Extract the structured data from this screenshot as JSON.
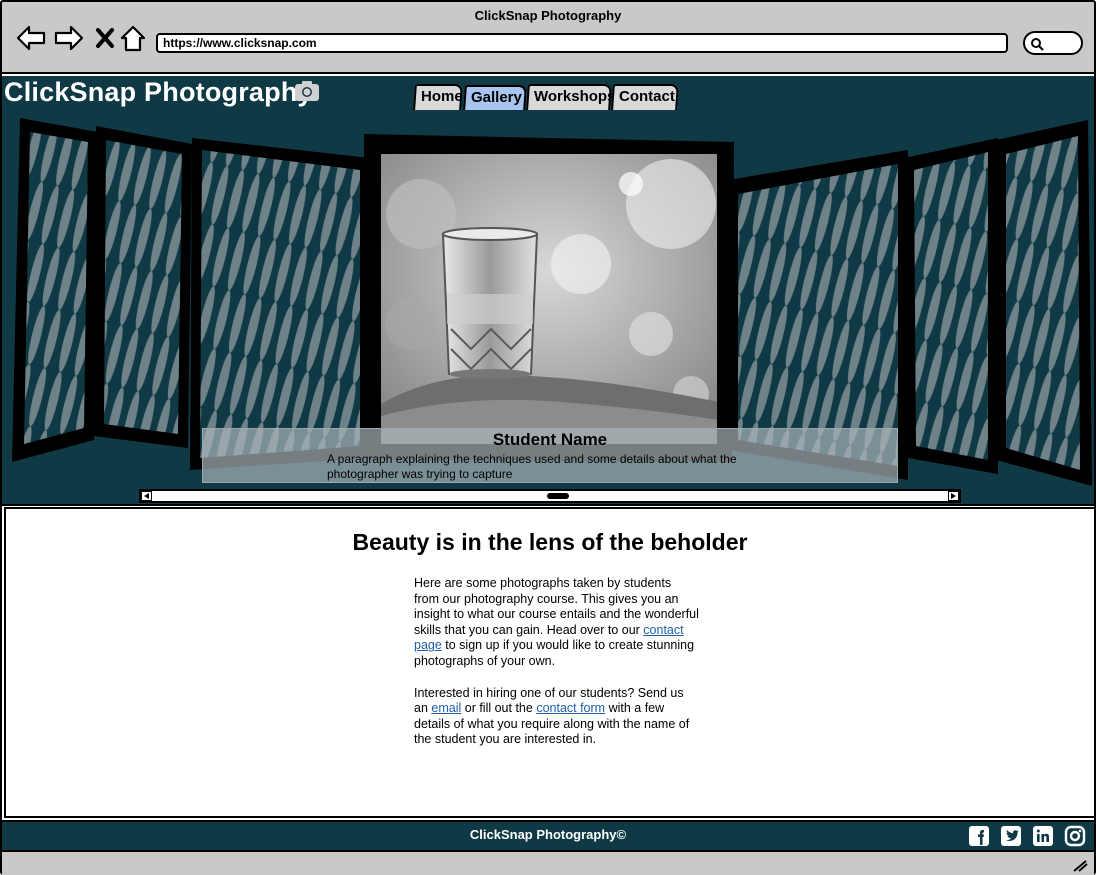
{
  "browser": {
    "window_title": "ClickSnap Photography",
    "url": "https://www.clicksnap.com",
    "icons": [
      "back-arrow-icon",
      "forward-arrow-icon",
      "close-icon",
      "home-icon",
      "search-icon"
    ]
  },
  "header": {
    "brand": "ClickSnap Photography",
    "brand_icon": "camera-icon",
    "tabs": [
      {
        "label": "Home",
        "active": false
      },
      {
        "label": "Gallery",
        "active": true
      },
      {
        "label": "Workshops",
        "active": false
      },
      {
        "label": "Contact",
        "active": false
      }
    ]
  },
  "carousel": {
    "caption_title": "Student Name",
    "caption_text": "A paragraph explaining the techniques used and some details about what the photographer was trying to capture"
  },
  "content": {
    "heading": "Beauty is in the lens of the beholder",
    "p1_before": "Here are some photographs taken by students from our photography course. This gives you an insight to what our course entails and the wonderful skills that you can gain. Head over to our ",
    "p1_link": "contact page",
    "p1_after": " to sign up if you would like to create stunning photographs of your own.",
    "p2_before": "Interested in hiring one of our students? Send us an ",
    "p2_link1": "email",
    "p2_middle": " or fill out the ",
    "p2_link2": "contact form",
    "p2_after": " with a few details of what you require along with the name of the student you are interested in."
  },
  "footer": {
    "text": "ClickSnap Photography©",
    "social_icons": [
      "facebook-icon",
      "twitter-icon",
      "linkedin-icon",
      "instagram-icon"
    ]
  },
  "colors": {
    "brand_dark": "#0f3a45",
    "tab_active": "#a8c4f0",
    "link": "#1f5fa8",
    "chrome_gray": "#c9c9c9"
  }
}
